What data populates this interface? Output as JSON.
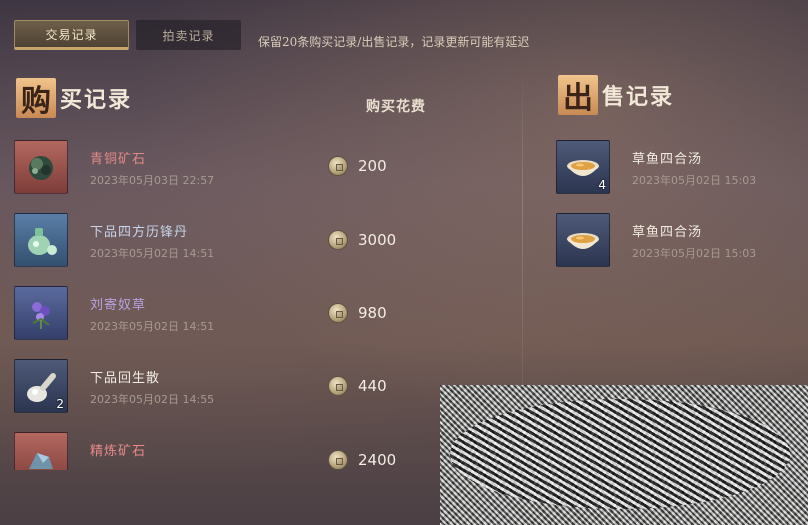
{
  "tabs": {
    "active_label": "交易记录",
    "inactive_label": "拍卖记录"
  },
  "notice": "保留20条购买记录/出售记录，记录更新可能有延迟",
  "buy_section": {
    "title_badge": "购",
    "title_rest": "买记录",
    "cost_header": "购买花费",
    "items": [
      {
        "name": "青铜矿石",
        "time": "2023年05月03日 22:57",
        "price": "200",
        "qty": "",
        "icon": "bronze-ore-icon",
        "rarity": "red",
        "name_color": "#e08a86"
      },
      {
        "name": "下品四方历锋丹",
        "time": "2023年05月02日 14:51",
        "price": "3000",
        "qty": "",
        "icon": "green-gourd-pill-icon",
        "rarity": "blue",
        "name_color": "#c7d4ea"
      },
      {
        "name": "刘寄奴草",
        "time": "2023年05月02日 14:51",
        "price": "980",
        "qty": "",
        "icon": "purple-herb-icon",
        "rarity": "purple",
        "name_color": "#b7a3e0"
      },
      {
        "name": "下品回生散",
        "time": "2023年05月02日 14:55",
        "price": "440",
        "qty": "2",
        "icon": "white-bottle-icon",
        "rarity": "slate",
        "name_color": "#f2ece2"
      },
      {
        "name": "精炼矿石",
        "time": "",
        "price": "2400",
        "qty": "",
        "icon": "refined-ore-icon",
        "rarity": "red",
        "name_color": "#e88a8a"
      }
    ]
  },
  "sell_section": {
    "title_badge": "出",
    "title_rest": "售记录",
    "items": [
      {
        "name": "草鱼四合汤",
        "time": "2023年05月02日 15:03",
        "qty": "4",
        "icon": "fish-soup-bowl-icon"
      },
      {
        "name": "草鱼四合汤",
        "time": "2023年05月02日 15:03",
        "qty": "",
        "icon": "fish-soup-bowl-icon"
      }
    ]
  }
}
